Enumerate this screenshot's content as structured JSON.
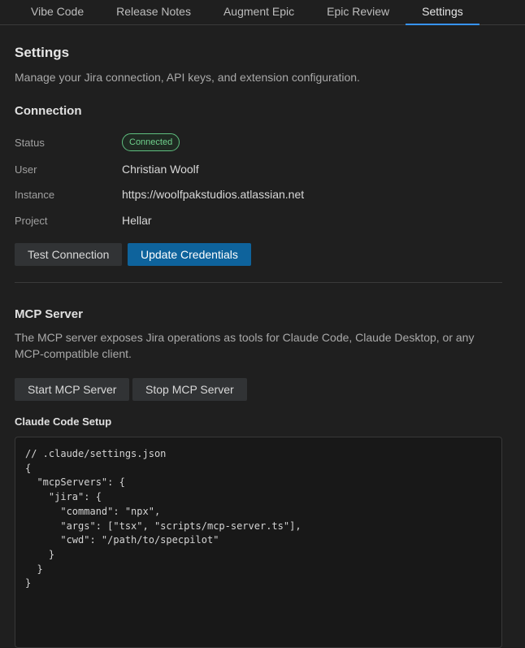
{
  "tabs": [
    {
      "label": "Vibe Code"
    },
    {
      "label": "Release Notes"
    },
    {
      "label": "Augment Epic"
    },
    {
      "label": "Epic Review"
    },
    {
      "label": "Settings",
      "active": true
    }
  ],
  "page": {
    "title": "Settings",
    "subtitle": "Manage your Jira connection, API keys, and extension configuration."
  },
  "connection": {
    "heading": "Connection",
    "status_label": "Status",
    "status_value": "Connected",
    "user_label": "User",
    "user_value": "Christian Woolf",
    "instance_label": "Instance",
    "instance_value": "https://woolfpakstudios.atlassian.net",
    "project_label": "Project",
    "project_value": "Hellar",
    "test_button": "Test Connection",
    "update_button": "Update Credentials"
  },
  "mcp": {
    "heading": "MCP Server",
    "description": "The MCP server exposes Jira operations as tools for Claude Code, Claude Desktop, or any MCP-compatible client.",
    "start_button": "Start MCP Server",
    "stop_button": "Stop MCP Server",
    "setup_heading": "Claude Code Setup",
    "code_lines": [
      "// .claude/settings.json",
      "{",
      "  \"mcpServers\": {",
      "    \"jira\": {",
      "      \"command\": \"npx\",",
      "      \"args\": [\"tsx\", \"scripts/mcp-server.ts\"],",
      "      \"cwd\": \"/path/to/specpilot\"",
      "    }",
      "  }",
      "}"
    ]
  },
  "colors": {
    "accent": "#3794ff",
    "primary_button": "#0e639c",
    "connected": "#6fd08c",
    "background": "#1f1f1f"
  }
}
